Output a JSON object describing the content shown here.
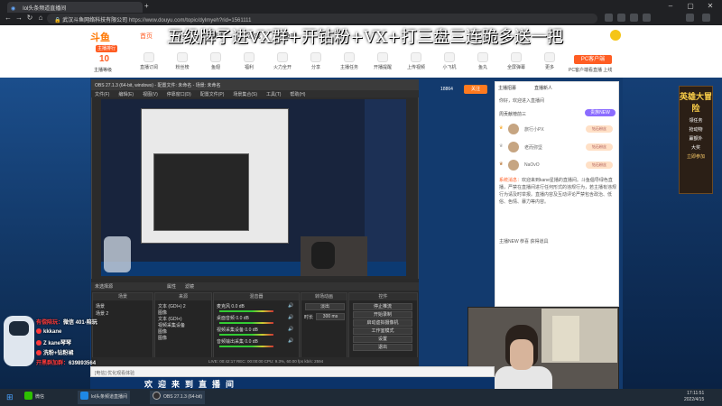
{
  "browser": {
    "tab_title": "lol头条频道直播间",
    "url_site": "武汉斗鱼网络科技有限公司",
    "url": "https://www.douyu.com/topic/dylmyeh?rid=1561111"
  },
  "douyu": {
    "logo": "斗鱼",
    "nav": [
      "首页",
      "分类",
      "赛事",
      "游戏",
      "鱼吧"
    ],
    "active_nav": 0,
    "headline_overlay": "五级牌子进VX群+开钻粉+VX+打三盘三连跪多送一把",
    "level_number": "10",
    "level_label": "主播等级",
    "red_button": "主播排行",
    "categories": [
      "直播订阅",
      "粉丝榜",
      "鱼翅",
      "福利",
      "火力全开",
      "分享",
      "主播任务",
      "开播提醒",
      "上传视频",
      "小飞机",
      "鱼丸",
      "全屏弹幕",
      "更多"
    ],
    "pc_client": "PC客户端",
    "pc_client_sub": "PC客户端看直播 上线"
  },
  "stream_preview": {
    "button_primary": "关注",
    "button_secondary": "18864"
  },
  "promo": {
    "title": "英雄大冒险",
    "lines": [
      "领任务",
      "抢动物",
      "赢额外",
      "大奖",
      "立即参加"
    ]
  },
  "chat": {
    "tabs": [
      "主播招募",
      "直播新人"
    ],
    "subtitle": "你好，欢迎进入直播间",
    "rank_header": "周贡献榜前三",
    "rank_button": "贵族NEW",
    "ranks": [
      {
        "name": "旅行小PX",
        "medal": "钻石粉丝"
      },
      {
        "name": "老而弥坚",
        "medal": "钻石粉丝"
      },
      {
        "name": "NaOvO",
        "medal": "钻石粉丝"
      }
    ],
    "system_label": "系统消息：",
    "system_text": "欢迎来到kane星播的直播间。斗鱼倡导绿色直播，严禁在直播间进行任何形式的违规行为，若主播有违规行为请及时举报。直播内容及互动评论严禁包含政治、低俗、色情、暴力等内容。",
    "last_line": "主播NEW 恭喜 获得道具"
  },
  "obs": {
    "title": "OBS 27.1.3 (64-bit, windows) - 配置文件: 未命名 - 场景: 未命名",
    "menu": [
      "文件(F)",
      "编辑(E)",
      "视图(V)",
      "停靠窗口(D)",
      "配置文件(P)",
      "场景集合(S)",
      "工具(T)",
      "帮助(H)"
    ],
    "dock_bar": "未选择源",
    "dock_buttons": [
      "属性",
      "滤镜"
    ],
    "docks": {
      "scenes": {
        "title": "场景",
        "items": [
          "场景",
          "场景 2"
        ]
      },
      "sources": {
        "title": "来源",
        "items": [
          "文本 (GDI+) 2",
          "图像",
          "文本 (GDI+)",
          "视频采集设备",
          "图像",
          "图像"
        ]
      },
      "mixer": {
        "title": "混音器",
        "items": [
          "麦克风",
          "桌面音频",
          "视频采集设备",
          "音频输出采集"
        ],
        "levels": [
          "0.0 dB",
          "0.0 dB",
          "0.0 dB",
          "0.0 dB"
        ]
      },
      "transitions": {
        "title": "转场动画",
        "type": "淡出",
        "duration_label": "时长",
        "duration": "300 ms"
      },
      "controls": {
        "title": "控件",
        "buttons": [
          "停止推流",
          "开始录制",
          "启动虚拟摄像机",
          "工作室模式",
          "设置",
          "退出"
        ]
      }
    },
    "status": "LIVE: 00:42:17   REC: 00:00:00   CPU: 9.3%, 60.00 fps   kb/s: 2594"
  },
  "overlay": {
    "line1_label": "有偿陪玩：",
    "line1_value": "微信 401-陪玩",
    "line2": "kkkane",
    "line3": "Z kane琴琴",
    "line4": "洗粉+钻粉裙",
    "line5_label": "开黑群加群：",
    "line5_value": "639893564"
  },
  "giftbar": {
    "placeholder": "[电信] 优化观看体验",
    "bottom_text": "欢迎来到直播间"
  },
  "taskbar": {
    "items": [
      "微信",
      "lol头条频道直播间",
      "OBS 27.1.3 (64-bit)"
    ],
    "time": "17:11:51",
    "date": "2022/4/15"
  }
}
